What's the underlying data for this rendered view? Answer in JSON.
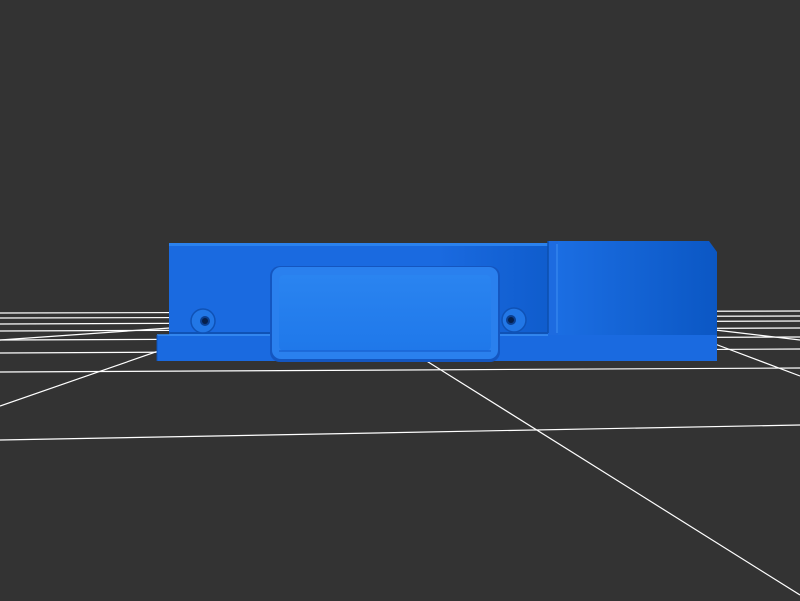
{
  "viewer": {
    "background_color": "#333333",
    "grid_color": "#ffffff",
    "model_color": "#1f6fe0",
    "model_highlight_color": "#2c86f2",
    "model_shadow_color": "#1457b8",
    "grid_visible": true
  },
  "model": {
    "name_icon": "blue-3d-part"
  }
}
